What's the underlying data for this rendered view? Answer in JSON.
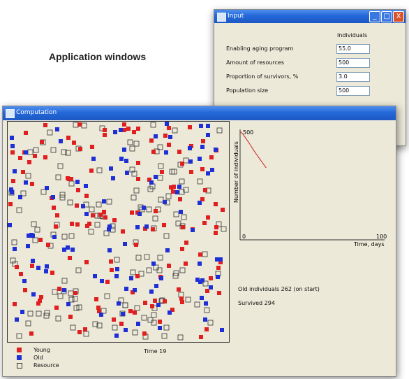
{
  "heading": "Application windows",
  "input_window": {
    "title": "Input",
    "column_header": "Individuals",
    "fields": [
      {
        "label": "Enabling aging program",
        "value": "55.0"
      },
      {
        "label": "Amount of resources",
        "value": "500"
      },
      {
        "label": "Proportion of survivors, %",
        "value": "3.0"
      },
      {
        "label": "Population size",
        "value": "500"
      }
    ],
    "buttons": {
      "minimize": "_",
      "maximize": "□",
      "close": "X"
    }
  },
  "computation_window": {
    "title": "Computation",
    "time_label": "Time 19",
    "old_info": "Old individuals 262 (on start)",
    "survived_info": "Survived  294",
    "legend": [
      {
        "label": "Young",
        "color": "#e02020"
      },
      {
        "label": "Old",
        "color": "#1e2fd6"
      },
      {
        "label": "Resource",
        "color": "#ece9d8"
      }
    ]
  },
  "chart_data": {
    "type": "line",
    "ylabel": "Number of individuals",
    "xlabel": "Time, days",
    "y_top_tick": "500",
    "x_min_tick": "0",
    "x_max_tick": "100",
    "xlim": [
      0,
      100
    ],
    "ylim": [
      0,
      500
    ],
    "series": [
      {
        "color": "#cc2020",
        "x": [
          0,
          2,
          4,
          6,
          8,
          10,
          12,
          14,
          16,
          18,
          19
        ],
        "y": [
          500,
          488,
          470,
          452,
          432,
          412,
          394,
          376,
          358,
          340,
          332
        ]
      }
    ]
  },
  "colors": {
    "young": "#e02020",
    "old": "#1e2fd6",
    "resource_border": "#333333",
    "title_bar": "#2468d8"
  }
}
